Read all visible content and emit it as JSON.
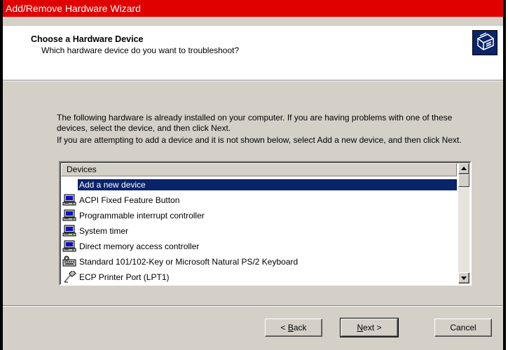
{
  "window": {
    "title": "Add/Remove Hardware Wizard",
    "title_bar_color": "#e00000"
  },
  "header": {
    "title": "Choose a Hardware Device",
    "subtitle": "Which hardware device do you want to troubleshoot?",
    "icon": "hardware-wizard-icon"
  },
  "body": {
    "paragraph1": "The following hardware is already installed on your computer. If you are having problems with one of these devices, select the device, and then click Next.",
    "paragraph2": "If you are attempting to add a device and it is not shown below, select Add a new device, and then click Next."
  },
  "devices": {
    "column_header": "Devices",
    "items": [
      {
        "label": "Add a new device",
        "icon": "none",
        "selected": true
      },
      {
        "label": "ACPI Fixed Feature Button",
        "icon": "computer-icon",
        "selected": false
      },
      {
        "label": "Programmable interrupt controller",
        "icon": "computer-icon",
        "selected": false
      },
      {
        "label": "System timer",
        "icon": "computer-icon",
        "selected": false
      },
      {
        "label": "Direct memory access controller",
        "icon": "computer-icon",
        "selected": false
      },
      {
        "label": "Standard 101/102-Key or Microsoft Natural PS/2 Keyboard",
        "icon": "keyboard-icon",
        "selected": false
      },
      {
        "label": "ECP Printer Port (LPT1)",
        "icon": "printer-port-icon",
        "selected": false
      }
    ],
    "selection_color": "#0a246a"
  },
  "buttons": {
    "back_prefix": "< ",
    "back_mnemonic": "B",
    "back_rest": "ack",
    "next_mnemonic": "N",
    "next_rest": "ext >",
    "cancel": "Cancel"
  }
}
